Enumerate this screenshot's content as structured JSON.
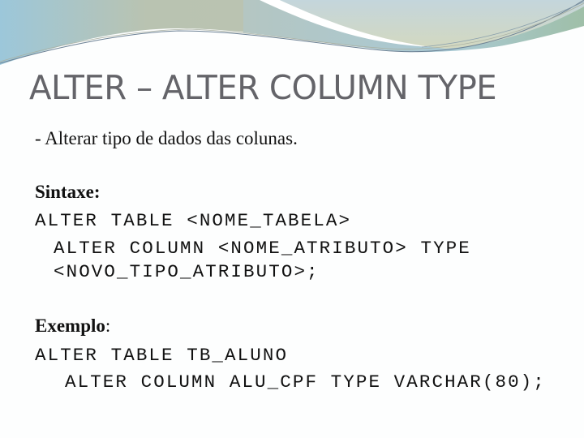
{
  "slide": {
    "title": "ALTER – ALTER COLUMN TYPE",
    "bullet": "- Alterar tipo de dados das colunas.",
    "syntax": {
      "label": "Sintaxe",
      "colon": ":",
      "lines": [
        "ALTER TABLE <NOME_TABELA>",
        "ALTER COLUMN <NOME_ATRIBUTO> TYPE",
        "<NOVO_TIPO_ATRIBUTO>;"
      ]
    },
    "example": {
      "label": "Exemplo",
      "colon": ":",
      "lines": [
        "ALTER TABLE TB_ALUNO",
        "ALTER COLUMN ALU_CPF TYPE VARCHAR(80);"
      ]
    }
  },
  "theme": {
    "title_color": "#646469",
    "text_color": "#111111",
    "header_band_color": "#bcc3b0",
    "header_blue": "#a7c8d3",
    "header_line_color": "#6d8295"
  }
}
